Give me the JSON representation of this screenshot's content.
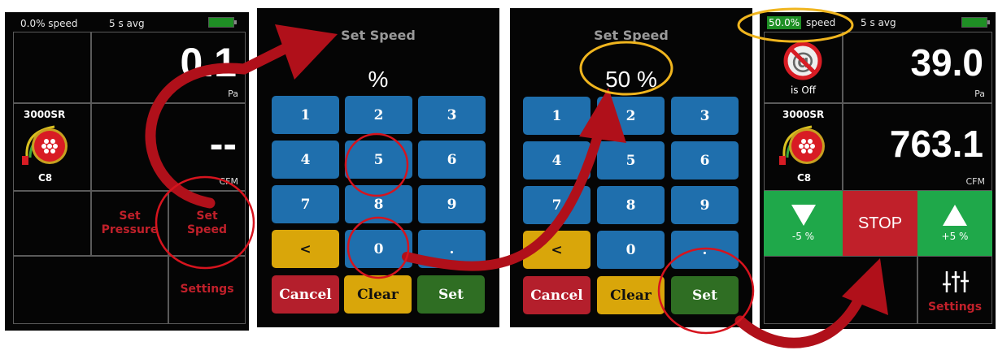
{
  "panel1": {
    "speed_status": "0.0% speed",
    "avg_label": "5 s avg",
    "pressure_value": "0.1",
    "pressure_unit": "Pa",
    "fan_model": "3000SR",
    "fan_ring": "C8",
    "flow_value": "--",
    "flow_unit": "CFM",
    "set_pressure_line1": "Set",
    "set_pressure_line2": "Pressure",
    "set_speed_line1": "Set",
    "set_speed_line2": "Speed",
    "settings_label": "Settings"
  },
  "panel2": {
    "title": "Set Speed",
    "display": "%",
    "keys": [
      "1",
      "2",
      "3",
      "4",
      "5",
      "6",
      "7",
      "8",
      "9",
      "<",
      "0",
      "."
    ],
    "cancel": "Cancel",
    "clear": "Clear",
    "set": "Set"
  },
  "panel3": {
    "title": "Set Speed",
    "display": "50 %",
    "keys": [
      "1",
      "2",
      "3",
      "4",
      "5",
      "6",
      "7",
      "8",
      "9",
      "<",
      "0",
      "."
    ],
    "cancel": "Cancel",
    "clear": "Clear",
    "set": "Set"
  },
  "panel4": {
    "speed_value": "50.0%",
    "speed_word": "speed",
    "avg_label": "5 s avg",
    "device_status": "is Off",
    "pressure_value": "39.0",
    "pressure_unit": "Pa",
    "fan_model": "3000SR",
    "fan_ring": "C8",
    "flow_value": "763.1",
    "flow_unit": "CFM",
    "decrease_label": "-5 %",
    "stop_label": "STOP",
    "increase_label": "+5 %",
    "settings_label": "Settings"
  },
  "colors": {
    "key_blue": "#1f6fad",
    "key_yellow": "#d9a60a",
    "cancel_red": "#b41f2c",
    "set_green": "#2f6e23",
    "stop_red": "#c0202a",
    "step_green": "#1fa84a",
    "callout_arrow": "#b0101a",
    "highlight_ring_red": "#d6141e",
    "highlight_ring_yellow": "#f0b51e"
  }
}
